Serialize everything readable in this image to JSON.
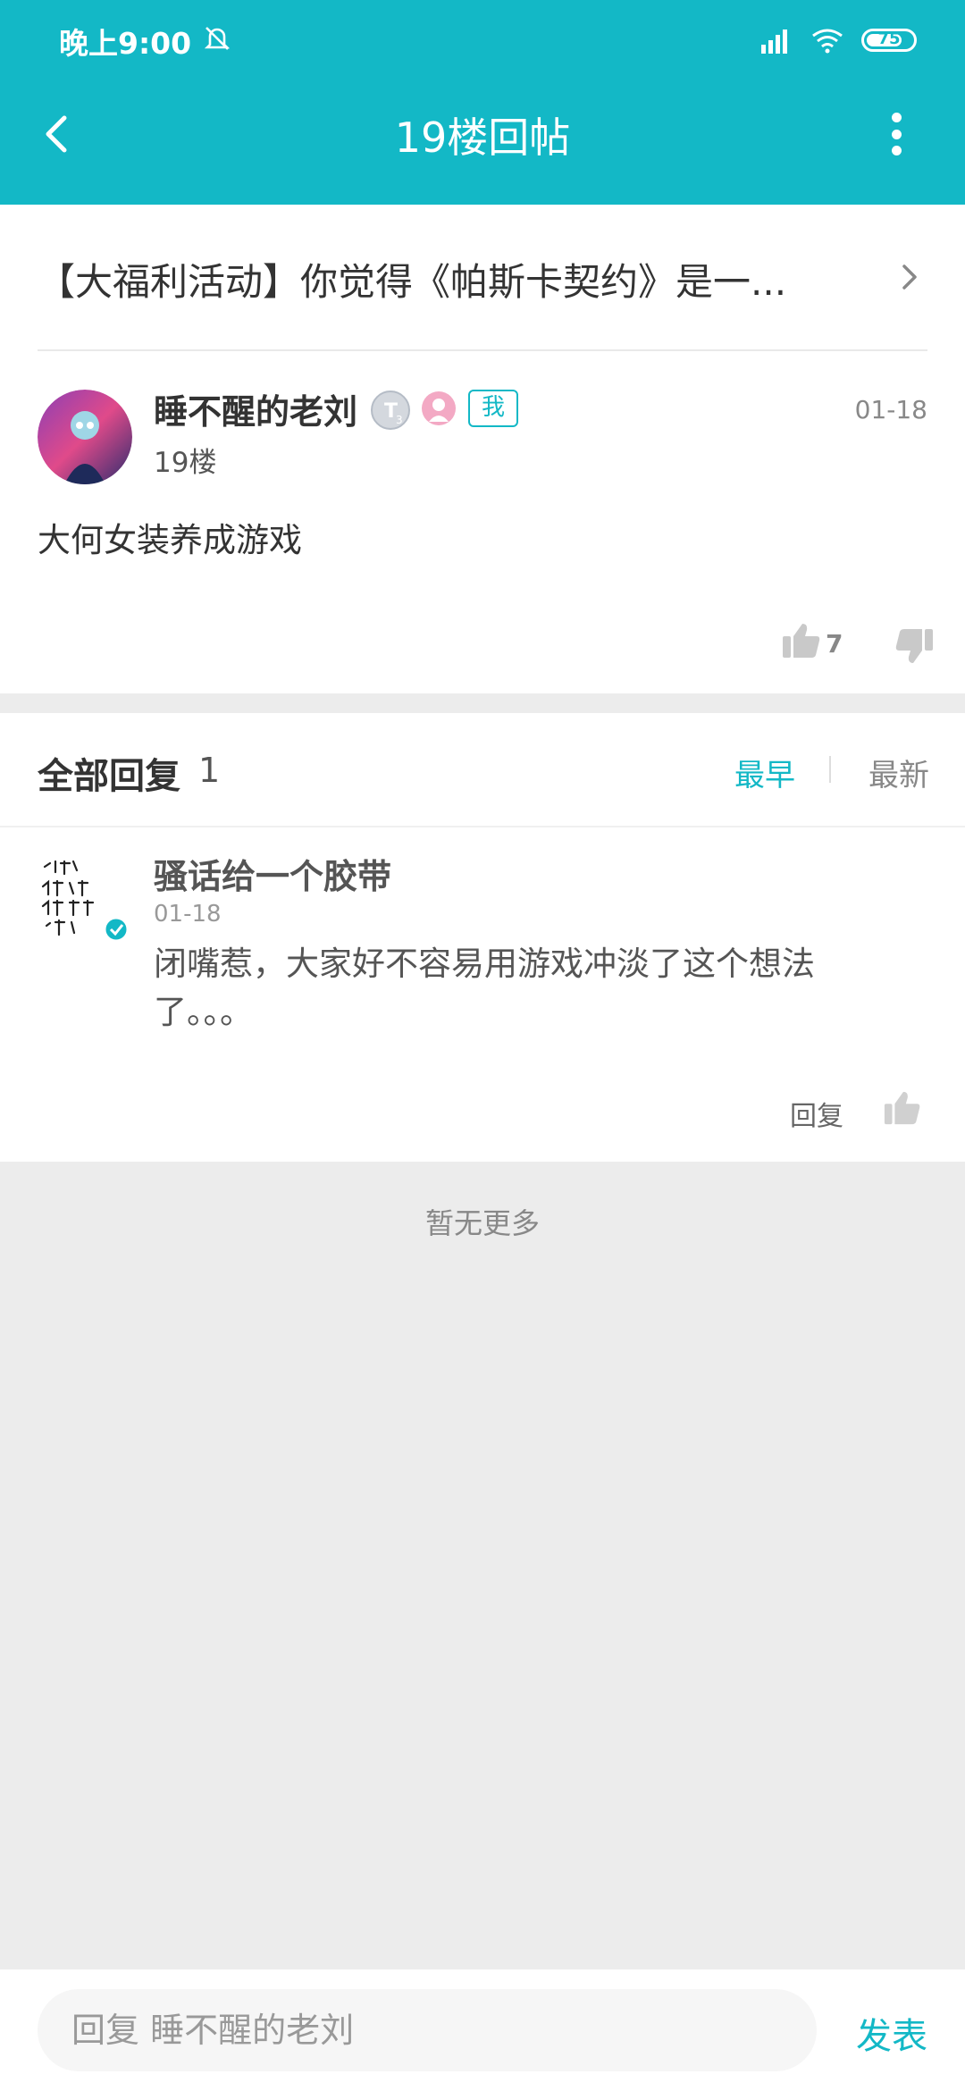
{
  "status_bar": {
    "time": "晚上9:00",
    "battery": "75"
  },
  "header": {
    "title": "19楼回帖"
  },
  "thread": {
    "title": "【大福利活动】你觉得《帕斯卡契约》是一..."
  },
  "post": {
    "author": "睡不醒的老刘",
    "me_badge": "我",
    "floor": "19楼",
    "date": "01-18",
    "content": "大何女装养成游戏",
    "like_count": "7"
  },
  "replies": {
    "heading": "全部回复",
    "count": "1",
    "sort_early": "最早",
    "sort_latest": "最新",
    "items": [
      {
        "author": "骚话给一个胶带",
        "date": "01-18",
        "content": "闭嘴惹，大家好不容易用游戏冲淡了这个想法了。。。",
        "reply_label": "回复"
      }
    ],
    "no_more": "暂无更多"
  },
  "bottom_bar": {
    "placeholder": "回复 睡不醒的老刘",
    "send": "发表"
  },
  "colors": {
    "accent": "#13b8c6",
    "background": "#ececec"
  }
}
